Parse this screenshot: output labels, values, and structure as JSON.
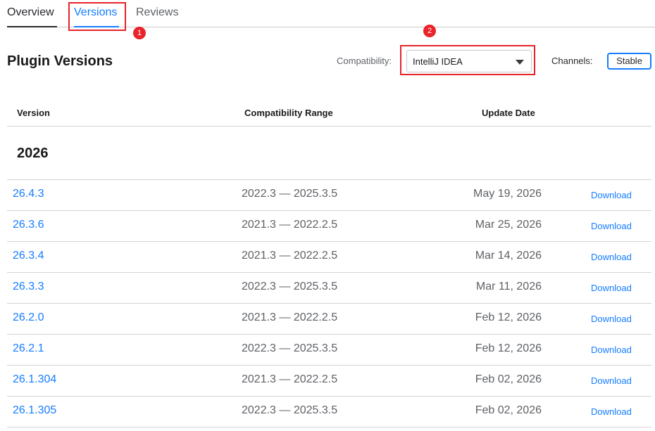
{
  "tabs": [
    {
      "label": "Overview"
    },
    {
      "label": "Versions"
    },
    {
      "label": "Reviews"
    }
  ],
  "annotations": {
    "badge1": "1",
    "badge2": "2"
  },
  "header": {
    "title": "Plugin Versions",
    "compatibility_label": "Compatibility:",
    "compatibility_value": "IntelliJ IDEA",
    "channels_label": "Channels:",
    "channel_button": "Stable"
  },
  "table": {
    "columns": [
      "Version",
      "Compatibility Range",
      "Update Date"
    ],
    "year": "2026",
    "download_label": "Download",
    "rows": [
      {
        "version": "26.4.3",
        "range": "2022.3 — 2025.3.5",
        "date": "May 19, 2026"
      },
      {
        "version": "26.3.6",
        "range": "2021.3 — 2022.2.5",
        "date": "Mar 25, 2026"
      },
      {
        "version": "26.3.4",
        "range": "2021.3 — 2022.2.5",
        "date": "Mar 14, 2026"
      },
      {
        "version": "26.3.3",
        "range": "2022.3 — 2025.3.5",
        "date": "Mar 11, 2026"
      },
      {
        "version": "26.2.0",
        "range": "2021.3 — 2022.2.5",
        "date": "Feb 12, 2026"
      },
      {
        "version": "26.2.1",
        "range": "2022.3 — 2025.3.5",
        "date": "Feb 12, 2026"
      },
      {
        "version": "26.1.304",
        "range": "2021.3 — 2022.2.5",
        "date": "Feb 02, 2026"
      },
      {
        "version": "26.1.305",
        "range": "2022.3 — 2025.3.5",
        "date": "Feb 02, 2026"
      }
    ]
  },
  "colors": {
    "accent": "#167dff",
    "annotation": "#e8232a"
  }
}
